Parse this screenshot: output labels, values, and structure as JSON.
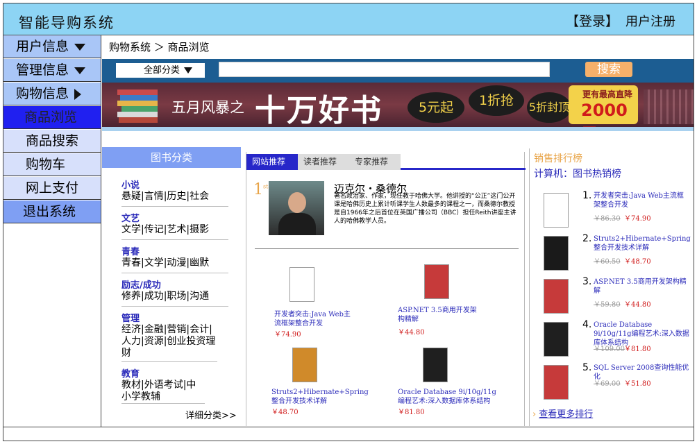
{
  "header": {
    "brand": "智能导购系统",
    "login": "【登录】",
    "register": "用户注册"
  },
  "nav": {
    "user_info": "用户信息",
    "admin_info": "管理信息",
    "shop_info": "购物信息",
    "browse": "商品浏览",
    "search": "商品搜索",
    "cart": "购物车",
    "pay": "网上支付",
    "logout": "退出系统"
  },
  "breadcrumb": "购物系统 ＞ 商品浏览",
  "search": {
    "category": "全部分类",
    "button": "搜索",
    "placeholder": ""
  },
  "banner": {
    "slogan": "五月风暴之",
    "headline": "十万好书",
    "bubble1": "5元起",
    "bubble2": "1折抢",
    "bubble3": "5折封顶",
    "promo_line": "更有最高直降",
    "promo_amount": "2000元"
  },
  "categories": {
    "heading": "图书分类",
    "groups": [
      {
        "title": "小说",
        "items": "悬疑|言情|历史|社会"
      },
      {
        "title": "文艺",
        "items": "文学|传记|艺术|摄影"
      },
      {
        "title": "青春",
        "items": "青春|文学|动漫|幽默"
      },
      {
        "title": "励志/成功",
        "items": "修养|成功|职场|沟通"
      },
      {
        "title": "管理",
        "items": "经济|金融|营销|会计|人力|资源|创业投资理财"
      },
      {
        "title": "教育",
        "items": "教材|外语考试|中小学教辅"
      }
    ],
    "more": "详细分类>>"
  },
  "recommend": {
    "tabs": [
      "网站推荐",
      "读者推荐",
      "专家推荐"
    ],
    "rank_no": "1",
    "rank_sup": "st",
    "author": "迈克尔・桑德尔",
    "desc": "著名政治家、作家，现任教于哈佛大学。他讲授的“公正”这门公开课是哈佛历史上累计听课学生人数最多的课程之一，而桑德尔教授是自1966年之后首位在英国广播公司（BBC）担任Reith讲座主讲人的哈佛教学人员。",
    "books": [
      {
        "title": "开发者突击:Java Web主流框架整合开发",
        "price": "￥74.90"
      },
      {
        "title": "ASP.NET 3.5商用开发架构精解",
        "price": "￥44.80"
      },
      {
        "title": "Struts2+Hibernate+Spring整合开发技术详解",
        "price": "￥48.70"
      },
      {
        "title": "Oracle Database 9i/10g/11g编程艺术:深入数据库体系结构",
        "price": "￥81.80"
      }
    ]
  },
  "ranking": {
    "title": "销售排行榜",
    "subtitle": "计算机：图书热销榜",
    "items": [
      {
        "no": "1.",
        "title": "开发者突击:Java Web主流框架整合开发",
        "old": "￥86.30",
        "new": "￥74.90"
      },
      {
        "no": "2.",
        "title": "Struts2+Hibernate+Spring整合开发技术详解",
        "old": "￥60.50",
        "new": "￥48.70"
      },
      {
        "no": "3.",
        "title": "ASP.NET 3.5商用开发架构精解",
        "old": "￥59.80",
        "new": "￥44.80"
      },
      {
        "no": "4.",
        "title": "Oracle Database 9i/10g/11g编程艺术:深入数据库体系结构",
        "old": "￥109.00",
        "new": "￥81.80"
      },
      {
        "no": "5.",
        "title": "SQL Server 2008查询性能优化",
        "old": "￥69.00",
        "new": "￥51.80"
      }
    ],
    "more": "查看更多排行"
  },
  "colors": {
    "topbar": "#8dd4f4",
    "nav_selected": "#2020f0",
    "accent": "#2929b9",
    "price": "#d01b1b"
  }
}
